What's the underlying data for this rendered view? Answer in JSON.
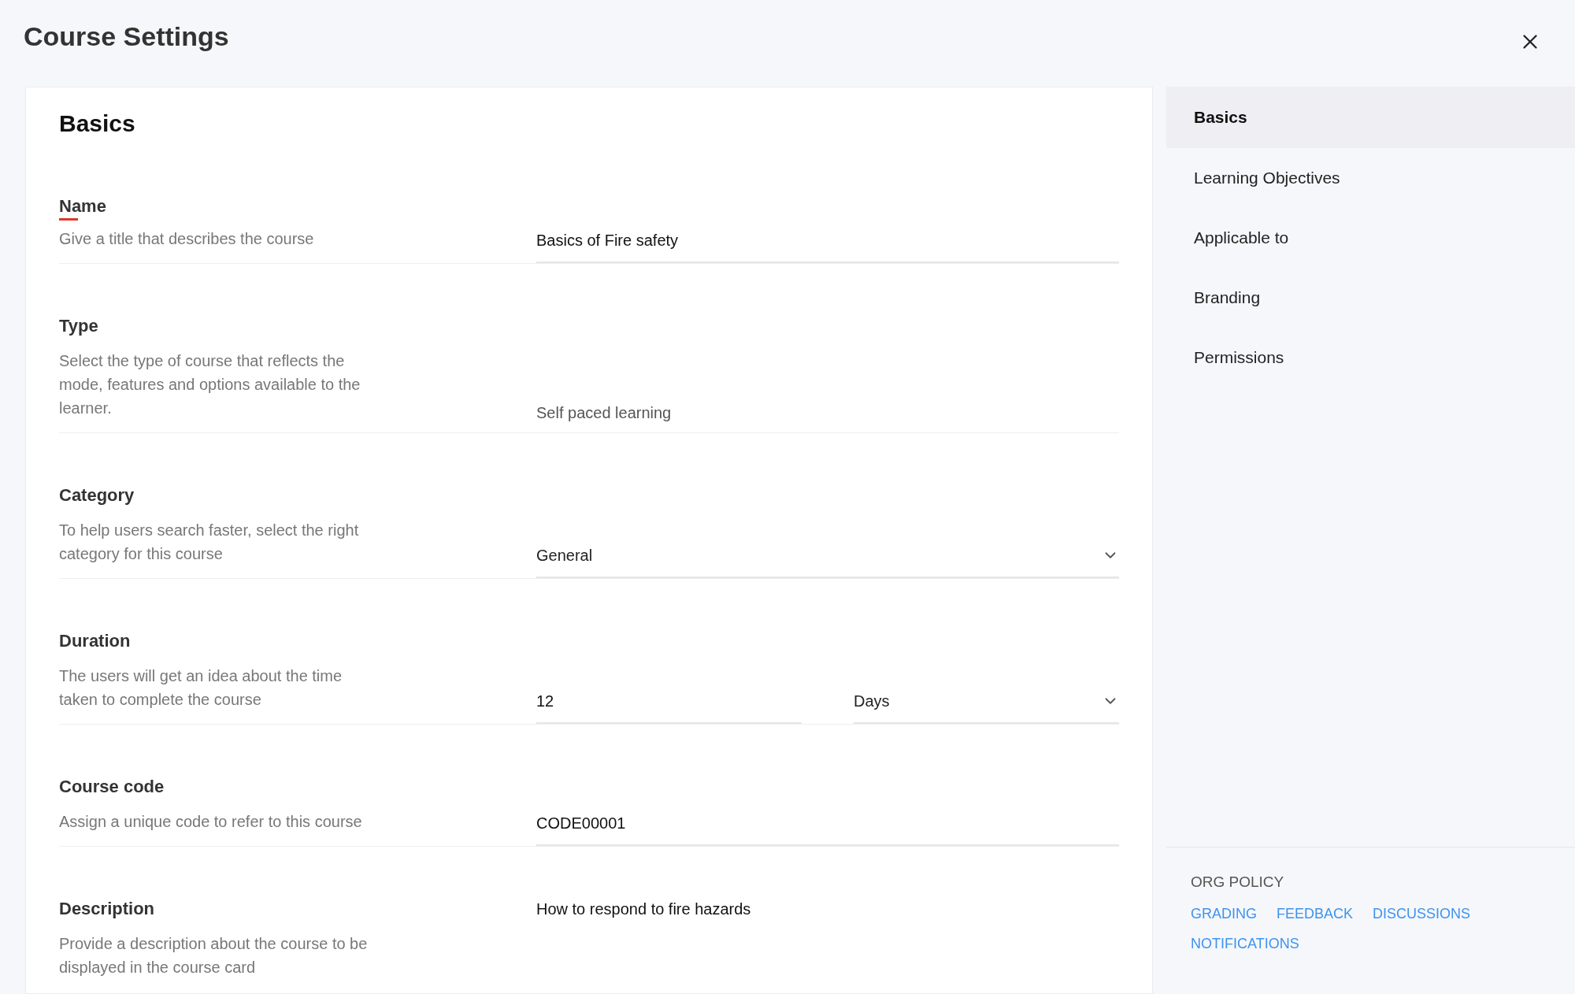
{
  "window": {
    "title": "Course Settings"
  },
  "section": {
    "title": "Basics"
  },
  "fields": [
    {
      "kind": "text",
      "label": "Name",
      "required": true,
      "description": "Give a title that describes the course",
      "value": "Basics of Fire safety"
    },
    {
      "kind": "static",
      "label": "Type",
      "required": false,
      "description": "Select the type of course that reflects the mode, features and options available to the learner.",
      "value": "Self paced learning"
    },
    {
      "kind": "select",
      "label": "Category",
      "required": false,
      "description": "To help users search faster, select the right category for this course",
      "value": "General"
    },
    {
      "kind": "duration",
      "label": "Duration",
      "required": false,
      "description": "The users will get an idea about the time taken to complete the course",
      "value": "12",
      "unit": "Days"
    },
    {
      "kind": "text",
      "label": "Course code",
      "required": false,
      "description": "Assign a unique code to refer to this course",
      "value": "CODE00001"
    },
    {
      "kind": "textarea",
      "label": "Description",
      "required": false,
      "description": "Provide a description about the course to be displayed in the course card",
      "value": "How to respond to fire hazards"
    }
  ],
  "sidebar": {
    "items": [
      {
        "label": "Basics",
        "selected": true
      },
      {
        "label": "Learning Objectives",
        "selected": false
      },
      {
        "label": "Applicable to",
        "selected": false
      },
      {
        "label": "Branding",
        "selected": false
      },
      {
        "label": "Permissions",
        "selected": false
      }
    ]
  },
  "org_policy": {
    "title": "ORG POLICY",
    "links": [
      "GRADING",
      "FEEDBACK",
      "DISCUSSIONS",
      "NOTIFICATIONS"
    ]
  }
}
